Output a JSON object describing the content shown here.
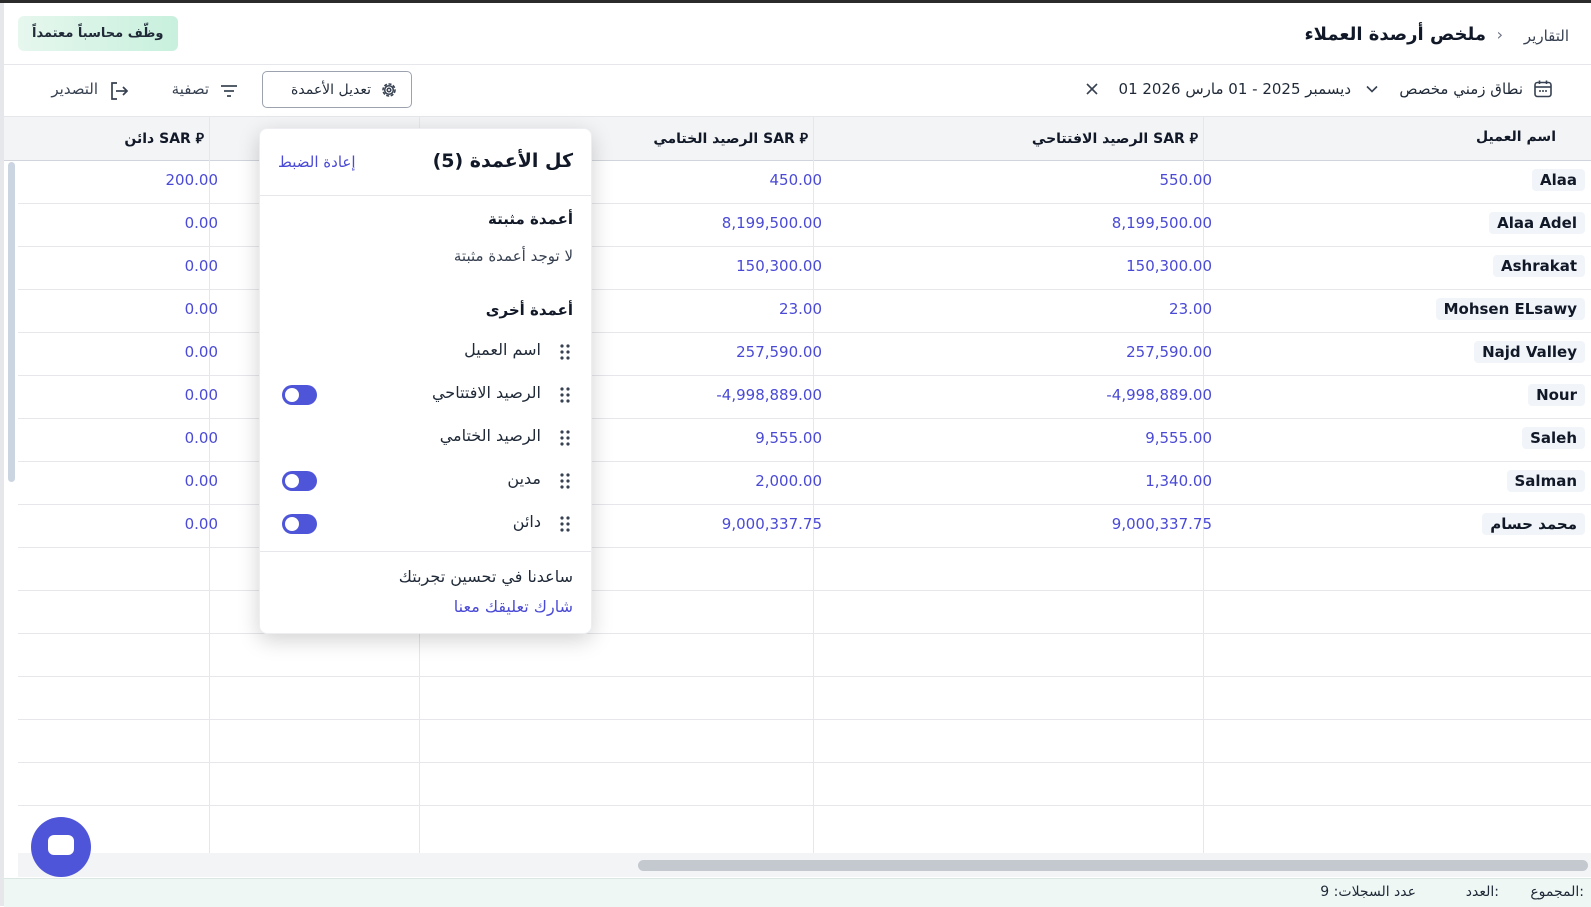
{
  "header": {
    "breadcrumb_parent": "التقارير",
    "breadcrumb_sep": "›",
    "title": "ملخص أرصدة العملاء",
    "promo_badge": "وظّف محاسباً معتمداً"
  },
  "toolbar": {
    "date_type": "نطاق زمني مخصص",
    "date_range": "01 ديسمبر 2025 - 01 مارس 2026",
    "edit_columns": "تعديل الأعمدة",
    "filter": "تصفية",
    "export": "التصدير"
  },
  "table": {
    "columns": {
      "name": "اسم العميل",
      "opening": "الرصيد الافتتاحي SAR ⃁",
      "closing": "الرصيد الختامي SAR ⃁",
      "credit": "دائن SAR ⃁"
    },
    "rows": [
      {
        "name": "Alaa",
        "opening": "550.00",
        "closing": "450.00",
        "credit": "200.00"
      },
      {
        "name": "Alaa Adel",
        "opening": "8,199,500.00",
        "closing": "8,199,500.00",
        "credit": "0.00"
      },
      {
        "name": "Ashrakat",
        "opening": "150,300.00",
        "closing": "150,300.00",
        "credit": "0.00"
      },
      {
        "name": "Mohsen ELsawy",
        "opening": "23.00",
        "closing": "23.00",
        "credit": "0.00"
      },
      {
        "name": "Najd Valley",
        "opening": "257,590.00",
        "closing": "257,590.00",
        "credit": "0.00"
      },
      {
        "name": "Nour",
        "opening": "-4,998,889.00",
        "closing": "-4,998,889.00",
        "credit": "0.00"
      },
      {
        "name": "Saleh",
        "opening": "9,555.00",
        "closing": "9,555.00",
        "credit": "0.00"
      },
      {
        "name": "Salman",
        "opening": "1,340.00",
        "closing": "2,000.00",
        "credit": "0.00"
      },
      {
        "name": "محمد حسام",
        "opening": "9,000,337.75",
        "closing": "9,000,337.75",
        "credit": "0.00"
      }
    ]
  },
  "footer": {
    "total": "المجموع:",
    "count": "العدد:",
    "records": "عدد السجلات: 9"
  },
  "columns_popover": {
    "title": "كل الأعمدة (5)",
    "reset": "إعادة الضبط",
    "pinned_heading": "أعمدة مثبتة",
    "pinned_empty": "لا توجد أعمدة مثبتة",
    "other_heading": "أعمدة أخرى",
    "items": [
      {
        "label": "اسم العميل",
        "toggle": false
      },
      {
        "label": "الرصيد الافتتاحي",
        "toggle": true
      },
      {
        "label": "الرصيد الختامي",
        "toggle": false
      },
      {
        "label": "مدين",
        "toggle": true
      },
      {
        "label": "دائن",
        "toggle": true
      }
    ],
    "help_text": "ساعدنا في تحسين تجربتك",
    "feedback_link": "شارك تعليقك معنا"
  },
  "colors": {
    "accent": "#4f55d9",
    "link": "#4a4ad6",
    "promo_bg": "#c8f0dd"
  }
}
